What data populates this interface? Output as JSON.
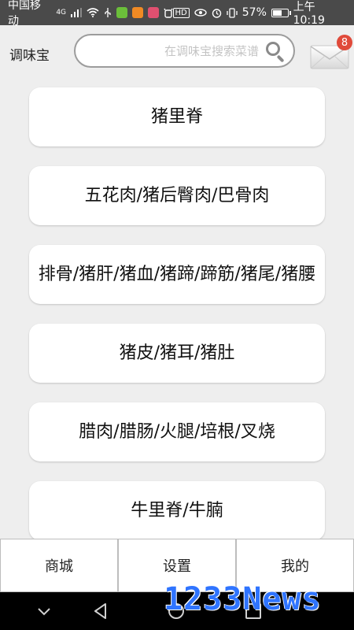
{
  "status_bar": {
    "carrier": "中国移动",
    "signal_type": "4G",
    "battery_percent": "57%",
    "time": "上午10:19",
    "battery_level": 0.57,
    "hd_label": "HD"
  },
  "header": {
    "app_title": "调味宝",
    "search_placeholder": "在调味宝搜索菜谱",
    "mail_badge_count": "8"
  },
  "categories": [
    {
      "label": "猪里脊"
    },
    {
      "label": "五花肉/猪后臀肉/巴骨肉"
    },
    {
      "label": "排骨/猪肝/猪血/猪蹄/蹄筋/猪尾/猪腰"
    },
    {
      "label": "猪皮/猪耳/猪肚"
    },
    {
      "label": "腊肉/腊肠/火腿/培根/叉烧"
    },
    {
      "label": "牛里脊/牛腩"
    }
  ],
  "tabs": [
    {
      "label": "商城"
    },
    {
      "label": "设置"
    },
    {
      "label": "我的"
    }
  ],
  "watermark": "1233News",
  "colors": {
    "status_bar_bg": "#4a4a4a",
    "page_bg": "#eeeeee",
    "badge": "#e04a3a",
    "watermark": "#2f74ff"
  }
}
